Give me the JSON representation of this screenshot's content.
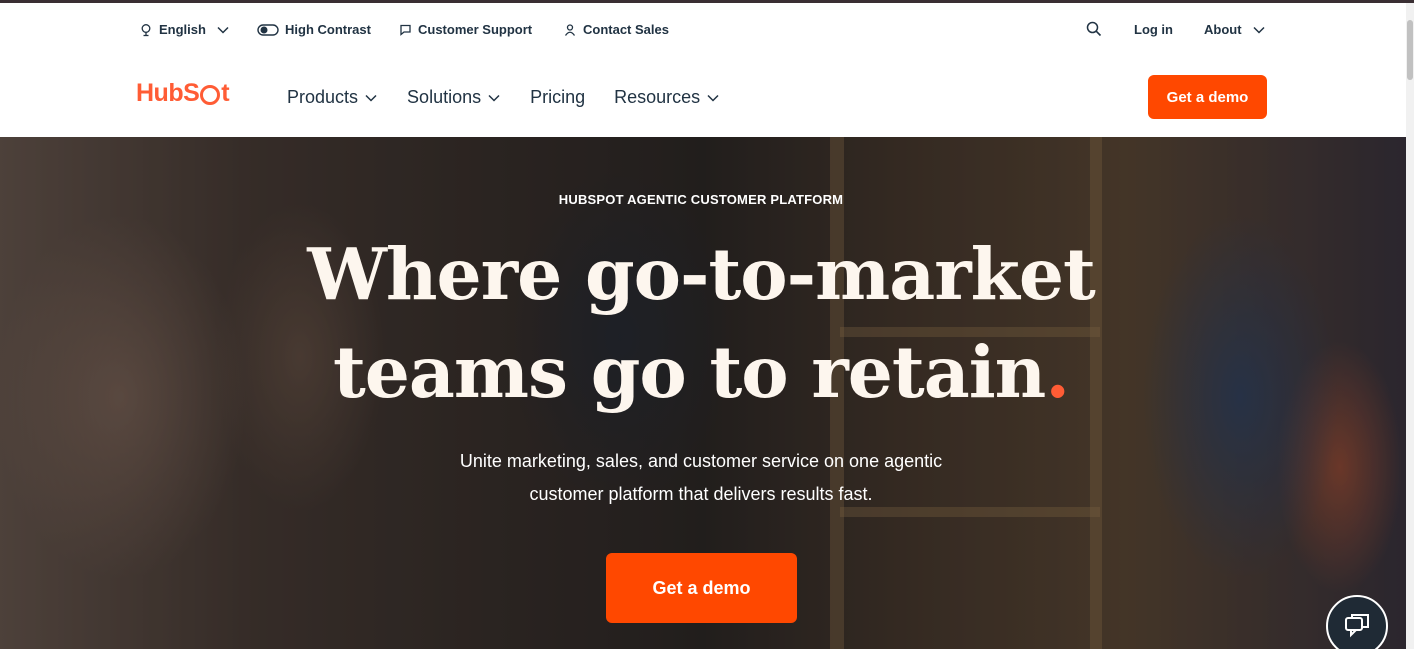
{
  "utility_bar": {
    "language": "English",
    "high_contrast": "High Contrast",
    "customer_support": "Customer Support",
    "contact_sales": "Contact Sales",
    "login": "Log in",
    "about": "About"
  },
  "brand": {
    "logo_text_pre": "HubS",
    "logo_text_post": "t",
    "accent": "#ff4800"
  },
  "nav": {
    "products": "Products",
    "solutions": "Solutions",
    "pricing": "Pricing",
    "resources": "Resources",
    "cta": "Get a demo"
  },
  "hero": {
    "eyebrow": "HUBSPOT AGENTIC CUSTOMER PLATFORM",
    "headline_line1": "Where go-to-market",
    "headline_line2": "teams go to retain",
    "headline_dot": ".",
    "subtext_line1": "Unite marketing, sales, and customer service on one agentic",
    "subtext_line2": "customer platform that delivers results fast.",
    "cta": "Get a demo"
  },
  "icons": {
    "language": "globe-icon",
    "contrast": "toggle-icon",
    "support": "chat-bubble-icon",
    "sales": "person-icon",
    "search": "search-icon",
    "chat_widget": "chat-widget-icon"
  }
}
